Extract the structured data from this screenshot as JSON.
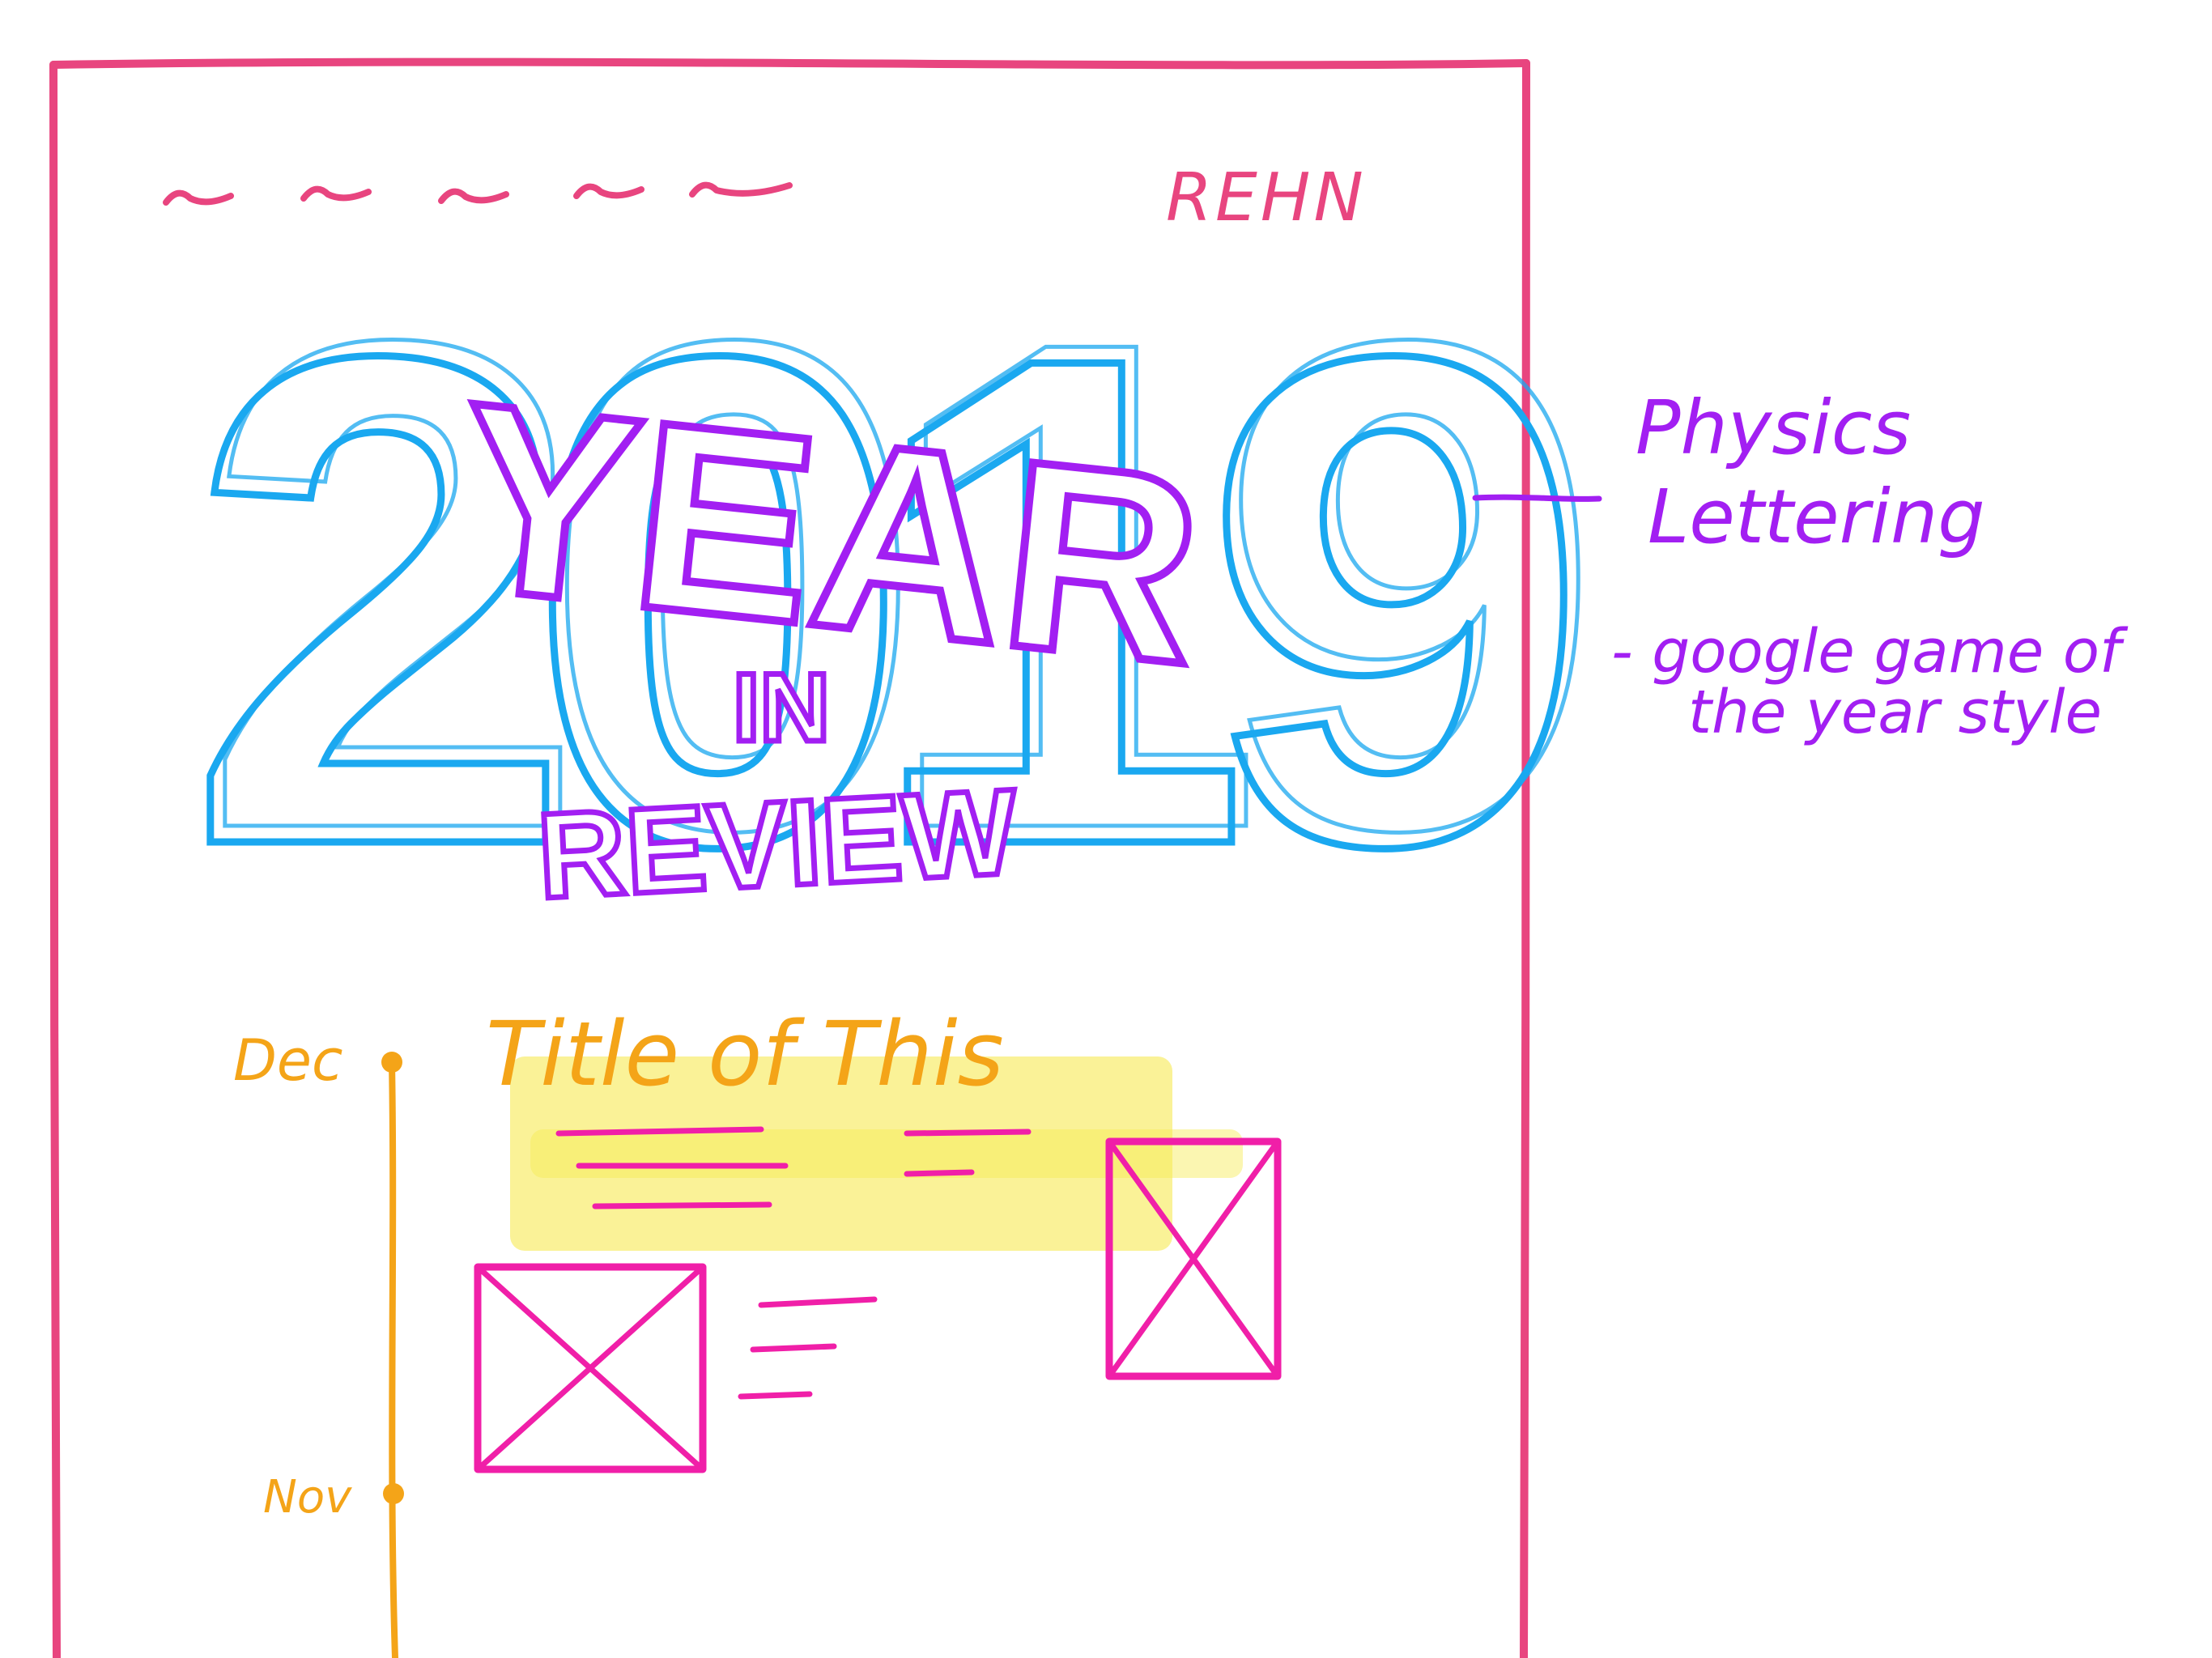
{
  "colors": {
    "frame": "#e8457f",
    "year_outline": "#1aa8f0",
    "lettering": "#a21ff2",
    "timeline": "#f4a418",
    "highlight": "#f6ea52",
    "placeholder": "#f01fa8"
  },
  "header": {
    "logo_text": "REHN"
  },
  "hero": {
    "year": "2019",
    "word_year": "YEAR",
    "word_in": "IN",
    "word_review": "REVIEW"
  },
  "annotation": {
    "title_line1": "Physics",
    "title_line2": "Lettering",
    "note_line1": "- google game of",
    "note_line2": "the year style"
  },
  "timeline": {
    "months": [
      "Dec",
      "Nov"
    ],
    "entry_title": "Title of This"
  },
  "icons": {
    "image_placeholder": "image-placeholder-icon"
  }
}
